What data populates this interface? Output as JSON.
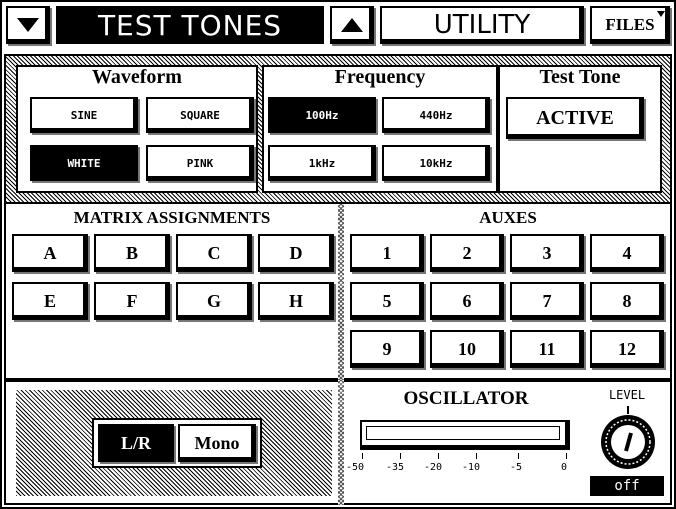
{
  "topbar": {
    "title": "TEST TONES",
    "utility": "UTILITY",
    "files": "FILES"
  },
  "waveform": {
    "label": "Waveform",
    "buttons": [
      "SINE",
      "SQUARE",
      "WHITE",
      "PINK"
    ],
    "selected": "WHITE"
  },
  "frequency": {
    "label": "Frequency",
    "buttons": [
      "100Hz",
      "440Hz",
      "1kHz",
      "10kHz"
    ],
    "selected": "100Hz"
  },
  "test_tone": {
    "label": "Test Tone",
    "button": "ACTIVE"
  },
  "matrix": {
    "label": "MATRIX ASSIGNMENTS",
    "buttons": [
      "A",
      "B",
      "C",
      "D",
      "E",
      "F",
      "G",
      "H"
    ]
  },
  "auxes": {
    "label": "AUXES",
    "buttons": [
      "1",
      "2",
      "3",
      "4",
      "5",
      "6",
      "7",
      "8",
      "9",
      "10",
      "11",
      "12"
    ]
  },
  "output": {
    "lr": "L/R",
    "mono": "Mono",
    "selected": "L/R"
  },
  "oscillator": {
    "label": "OSCILLATOR",
    "scale": [
      "-50",
      "-35",
      "-20",
      "-10",
      "-5",
      "0"
    ],
    "level_label": "LEVEL",
    "level_value": "off"
  },
  "colors": {
    "fg": "#000000",
    "bg": "#ffffff"
  }
}
